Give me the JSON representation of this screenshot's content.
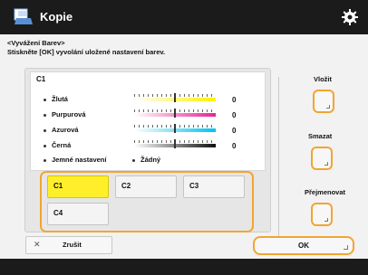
{
  "header": {
    "title": "Kopie",
    "app_icon": "copy-app-icon",
    "settings_icon": "gear-icon"
  },
  "instructions": {
    "title": "<Vyvážení Barev>",
    "text": "Stiskněte [OK] vyvolání uložené nastavení barev."
  },
  "panel": {
    "label": "C1",
    "rows": [
      {
        "label": "Žlutá",
        "value": "0",
        "color_left": "#ffffff",
        "color_right": "#fff200"
      },
      {
        "label": "Purpurová",
        "value": "0",
        "color_left": "#ffffff",
        "color_right": "#e8219a"
      },
      {
        "label": "Azurová",
        "value": "0",
        "color_left": "#ffffff",
        "color_right": "#00c2ef"
      },
      {
        "label": "Černá",
        "value": "0",
        "color_left": "#ffffff",
        "color_right": "#111111"
      }
    ],
    "fine_adjust": {
      "label": "Jemné nastavení",
      "value": "Žádný"
    }
  },
  "selection": {
    "buttons": [
      {
        "label": "C1",
        "active": true
      },
      {
        "label": "C2",
        "active": false
      },
      {
        "label": "C3",
        "active": false
      },
      {
        "label": "C4",
        "active": false
      }
    ]
  },
  "side": {
    "delete_label": "Vložit",
    "rename_label": "Smazat",
    "register_label": "Přejmenovat"
  },
  "footer": {
    "cancel_label": "Zrušit",
    "ok_label": "OK"
  },
  "colors": {
    "accent_orange": "#f2a531",
    "selected_yellow": "#ffef2a",
    "topbar": "#1b1b1b"
  }
}
